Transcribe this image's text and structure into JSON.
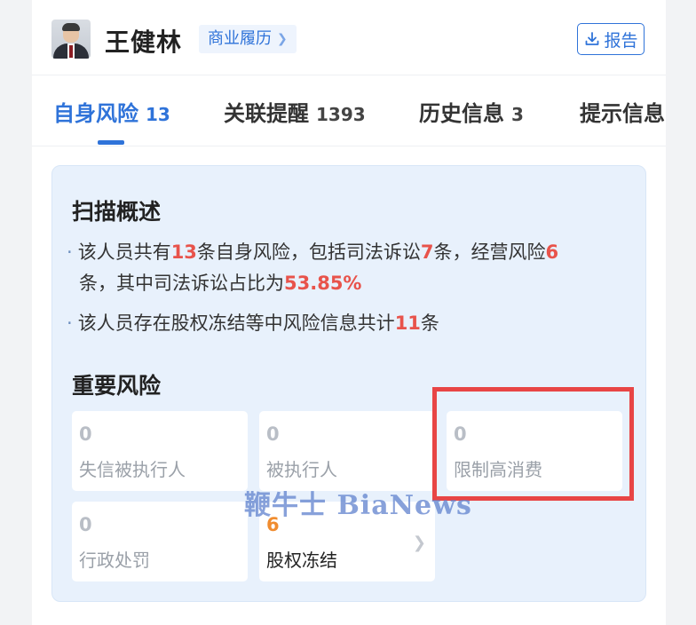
{
  "header": {
    "person_name": "王健林",
    "badge_label": "商业履历",
    "report_label": "报告",
    "report_icon": "download-icon"
  },
  "tabs": [
    {
      "label": "自身风险",
      "count": "13"
    },
    {
      "label": "关联提醒",
      "count": "1393"
    },
    {
      "label": "历史信息",
      "count": "3"
    },
    {
      "label": "提示信息",
      "count": ""
    }
  ],
  "summary": {
    "title": "扫描概述",
    "line1": {
      "t1": "该人员共有",
      "n1": "13",
      "t2": "条自身风险，包括司法诉讼",
      "n2": "7",
      "t3": "条，经营风险",
      "n3": "6",
      "t4": "条，其中司法诉讼占比为",
      "n4": "53.85%"
    },
    "line2": {
      "t1": "该人员存在股权冻结等中风险信息共计",
      "n1": "11",
      "t2": "条"
    }
  },
  "important": {
    "title": "重要风险",
    "tiles": [
      {
        "value": "0",
        "label": "失信被执行人"
      },
      {
        "value": "0",
        "label": "被执行人"
      },
      {
        "value": "0",
        "label": "限制高消费"
      },
      {
        "value": "0",
        "label": "行政处罚"
      },
      {
        "value": "6",
        "label": "股权冻结"
      }
    ]
  },
  "watermark": "鞭牛士 BiaNews",
  "colors": {
    "accent": "#2f73d9",
    "risk_red": "#e8534b",
    "highlight_box": "#e84545",
    "active_count": "#f08c2f"
  }
}
